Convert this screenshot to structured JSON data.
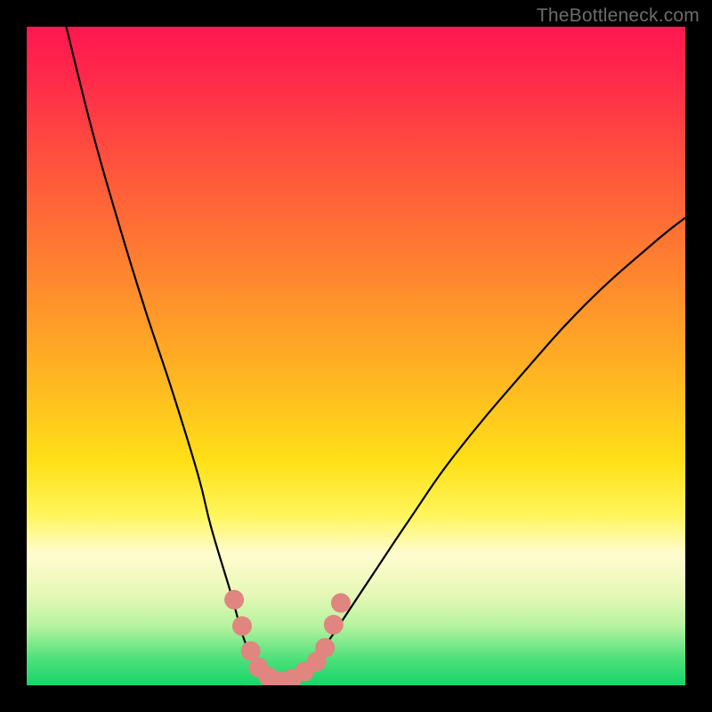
{
  "watermark": "TheBottleneck.com",
  "chart_data": {
    "type": "line",
    "title": "",
    "xlabel": "",
    "ylabel": "",
    "xlim": [
      0,
      100
    ],
    "ylim": [
      0,
      100
    ],
    "grid": false,
    "series": [
      {
        "name": "bottleneck-curve",
        "x": [
          6,
          10,
          14,
          18,
          22,
          26,
          28,
          31,
          33,
          35,
          37,
          38.5,
          40,
          43,
          46,
          52,
          58,
          65,
          75,
          85,
          95,
          100
        ],
        "y": [
          100,
          84,
          70,
          57,
          45,
          32,
          24,
          14,
          7,
          3,
          1,
          0.5,
          1,
          3,
          7,
          16,
          25,
          35,
          47,
          58,
          67,
          71
        ],
        "color": "#000000"
      }
    ],
    "markers": [
      {
        "name": "highlight-dot",
        "x": 31.5,
        "y": 13,
        "color": "#e0857f"
      },
      {
        "name": "highlight-dot",
        "x": 32.7,
        "y": 9,
        "color": "#e0857f"
      },
      {
        "name": "highlight-dot",
        "x": 34.0,
        "y": 5.2,
        "color": "#e0857f"
      },
      {
        "name": "highlight-dot",
        "x": 35.2,
        "y": 2.7,
        "color": "#e0857f"
      },
      {
        "name": "highlight-dot",
        "x": 36.7,
        "y": 1.3,
        "color": "#e0857f"
      },
      {
        "name": "highlight-dot",
        "x": 38.5,
        "y": 0.6,
        "color": "#e0857f"
      },
      {
        "name": "highlight-dot",
        "x": 40.3,
        "y": 1.0,
        "color": "#e0857f"
      },
      {
        "name": "highlight-dot",
        "x": 42.2,
        "y": 2.1,
        "color": "#e0857f"
      },
      {
        "name": "highlight-dot",
        "x": 44.0,
        "y": 3.6,
        "color": "#e0857f"
      },
      {
        "name": "highlight-dot",
        "x": 45.3,
        "y": 5.7,
        "color": "#e0857f"
      },
      {
        "name": "highlight-dot",
        "x": 46.6,
        "y": 9.2,
        "color": "#e0857f"
      },
      {
        "name": "highlight-dot",
        "x": 47.7,
        "y": 12.5,
        "color": "#e0857f"
      }
    ],
    "background_gradient": {
      "top": "#ff1750",
      "bottom": "#17d66a"
    }
  }
}
